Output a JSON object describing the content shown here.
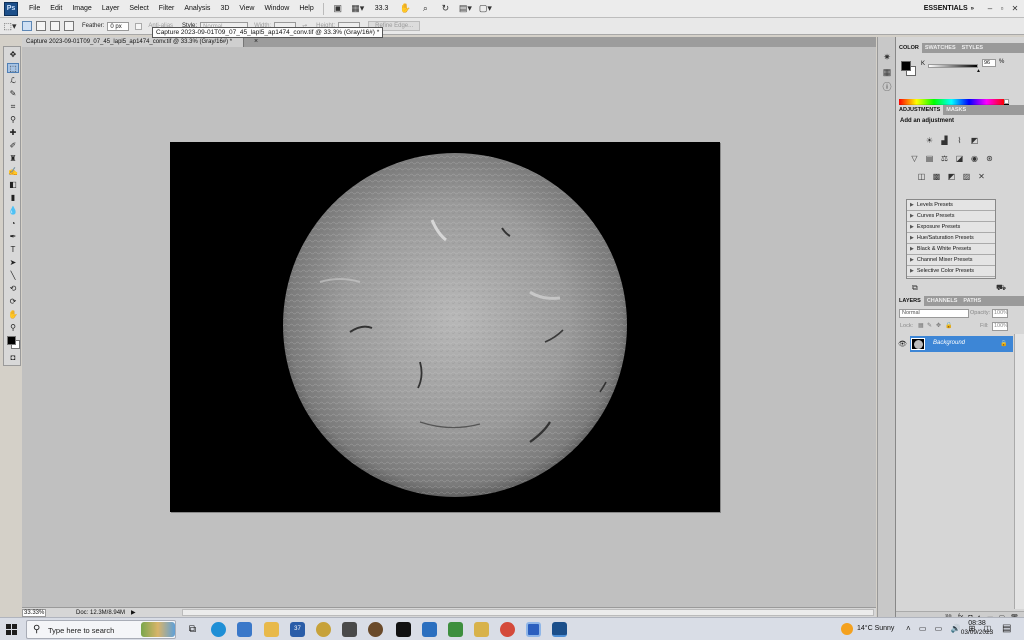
{
  "app": {
    "logo": "Ps",
    "menu": [
      "File",
      "Edit",
      "Image",
      "Layer",
      "Select",
      "Filter",
      "Analysis",
      "3D",
      "View",
      "Window",
      "Help"
    ],
    "zoom": "33.3",
    "workspace": "ESSENTIALS"
  },
  "options": {
    "feather_label": "Feather:",
    "feather_value": "0 px",
    "antialias_label": "Anti-alias",
    "style_label": "Style:",
    "style_value": "Normal",
    "width_label": "Width:",
    "height_label": "Height:",
    "refine_edge": "Refine Edge..."
  },
  "document": {
    "tab_title": "Capture 2023-09-01T09_07_45_lapl5_ap1474_conv.tif @ 33.3% (Gray/16#) *",
    "tooltip": "Capture 2023-09-01T09_07_45_lapl5_ap1474_conv.tif @ 33.3% (Gray/16#) *",
    "zoom_status": "33.33%",
    "doc_info": "Doc: 12.3M/8.94M"
  },
  "panels": {
    "color_tabs": [
      "COLOR",
      "SWATCHES",
      "STYLES"
    ],
    "k_label": "K",
    "k_value": "96",
    "k_unit": "%",
    "adjust_tabs": [
      "ADJUSTMENTS",
      "MASKS"
    ],
    "adjust_title": "Add an adjustment",
    "presets": [
      "Levels Presets",
      "Curves Presets",
      "Exposure Presets",
      "Hue/Saturation Presets",
      "Black & White Presets",
      "Channel Mixer Presets",
      "Selective Color Presets"
    ],
    "layers_tabs": [
      "LAYERS",
      "CHANNELS",
      "PATHS"
    ],
    "blend_mode": "Normal",
    "opacity_label": "Opacity:",
    "opacity_value": "100%",
    "lock_label": "Lock:",
    "fill_label": "Fill:",
    "fill_value": "100%",
    "layer_name": "Background"
  },
  "taskbar": {
    "search_placeholder": "Type here to search",
    "badge": "37",
    "weather": "14°C  Sunny",
    "time": "08:38",
    "date": "03/09/2023"
  },
  "colors": {
    "layer_selected": "#3d86d6",
    "ps_blue": "#1c4f8a",
    "canvas_bg": "#c0c0c0"
  }
}
